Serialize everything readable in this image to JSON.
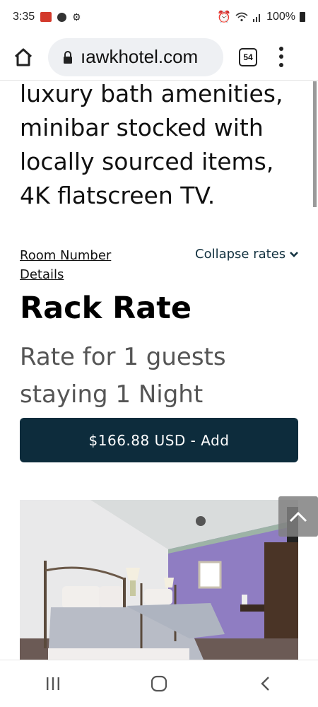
{
  "status_bar": {
    "time": "3:35",
    "battery_text": "100%",
    "icons": [
      "notification-icon",
      "account-icon",
      "settings-icon",
      "alarm-icon",
      "wifi-icon",
      "signal-icon",
      "battery-icon"
    ]
  },
  "browser": {
    "url": "ıawkhotel.com",
    "tab_count": "54"
  },
  "page": {
    "description": "luxury bath amenities, minibar stocked with locally sourced items, 4K flatscreen TV.",
    "room_link": "Room Number Details",
    "collapse_label": "Collapse rates",
    "rate_title": "Rack Rate",
    "rate_description": "Rate for 1 guests staying 1 Night",
    "add_button": "$166.88 USD - Add"
  },
  "colors": {
    "accent": "#0d2c3c",
    "collapse_text": "#12313f",
    "muted_text": "#555555",
    "wall_purple": "#8f7dc2"
  }
}
